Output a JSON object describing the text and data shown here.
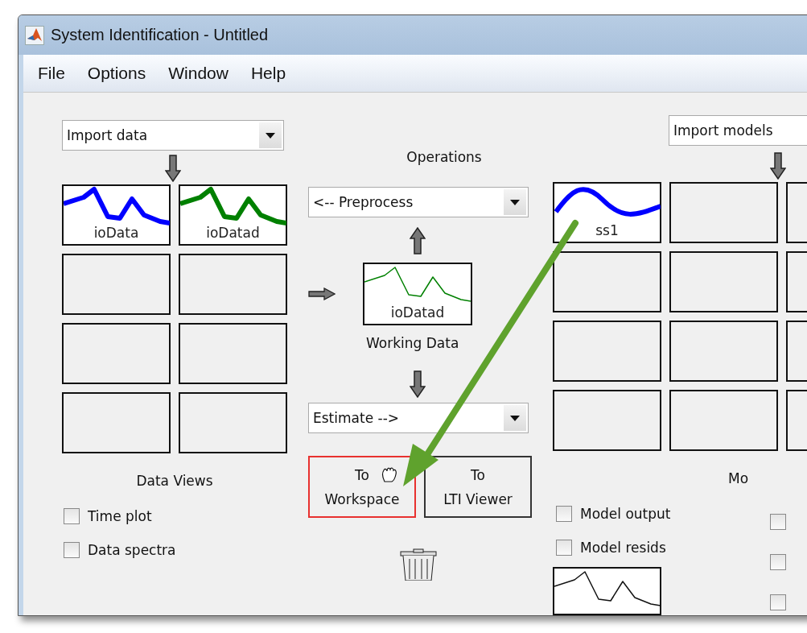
{
  "window": {
    "title": "System Identification - Untitled"
  },
  "menu": [
    "File",
    "Options",
    "Window",
    "Help"
  ],
  "data_panel": {
    "import": "Import data",
    "boards": [
      {
        "kind": "plot",
        "label": "ioData",
        "color": "#0000ff"
      },
      {
        "kind": "plot",
        "label": "ioDatad",
        "color": "#008000"
      },
      {
        "kind": "empty"
      },
      {
        "kind": "empty"
      },
      {
        "kind": "empty"
      },
      {
        "kind": "empty"
      },
      {
        "kind": "empty"
      },
      {
        "kind": "empty"
      }
    ],
    "title": "Data Views",
    "views": [
      {
        "label": "Time plot",
        "checked": false
      },
      {
        "label": "Data spectra",
        "checked": false
      }
    ]
  },
  "operations": {
    "title": "Operations",
    "preprocess": "<-- Preprocess",
    "working_data": {
      "label": "ioDatad",
      "caption": "Working Data"
    },
    "estimate": "Estimate -->",
    "buttons": [
      {
        "lines": [
          "To",
          "Workspace"
        ],
        "highlighted": true
      },
      {
        "lines": [
          "To",
          "LTI Viewer"
        ],
        "highlighted": false
      }
    ]
  },
  "model_panel": {
    "import": "Import models",
    "boards": [
      {
        "kind": "plot",
        "label": "ss1",
        "color": "#0000ff"
      },
      {
        "kind": "empty"
      },
      {
        "kind": "empty"
      },
      {
        "kind": "empty"
      },
      {
        "kind": "empty"
      },
      {
        "kind": "empty"
      },
      {
        "kind": "empty"
      },
      {
        "kind": "empty"
      },
      {
        "kind": "empty"
      },
      {
        "kind": "empty"
      },
      {
        "kind": "empty"
      },
      {
        "kind": "empty"
      }
    ],
    "title": "Mo",
    "views": [
      {
        "label": "Model output",
        "checked": false
      },
      {
        "label": "Model resids",
        "checked": false
      }
    ],
    "cut_views": [
      {
        "checked": false
      },
      {
        "checked": false
      },
      {
        "checked": false
      }
    ]
  }
}
